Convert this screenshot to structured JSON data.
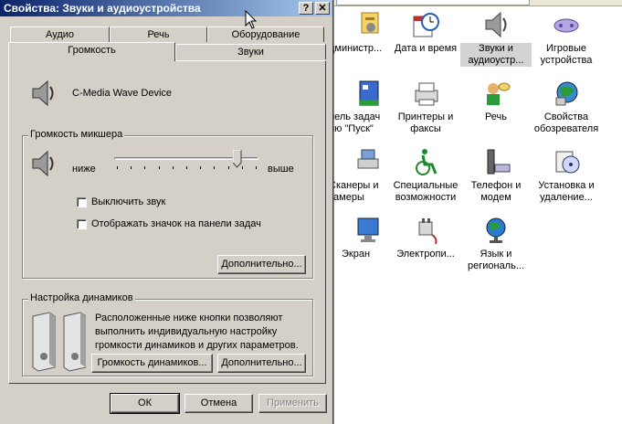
{
  "dialog": {
    "title": "Свойства: Звуки и аудиоустройства",
    "help_glyph": "?",
    "close_glyph": "✕",
    "tabs_back": [
      "Аудио",
      "Речь",
      "Оборудование"
    ],
    "tabs_front": [
      "Громкость",
      "Звуки"
    ],
    "active_tab": "Громкость",
    "device_name": "C-Media Wave Device",
    "mixer": {
      "group_label": "Громкость микшера",
      "low_label": "ниже",
      "high_label": "выше",
      "volume_level_fraction": 0.87,
      "mute_label": "Выключить звук",
      "mute_checked": false,
      "tray_icon_label": "Отображать значок на панели задач",
      "tray_icon_checked": false,
      "advanced_label": "Дополнительно..."
    },
    "speakers": {
      "group_label": "Настройка динамиков",
      "description": "Расположенные ниже кнопки позволяют выполнить индивидуальную настройку громкости динамиков и других параметров.",
      "desc_lines": [
        "Расположенные ниже кнопки позволяют",
        "выполнить индивидуальную настройку",
        "громкости динамиков и других параметров."
      ],
      "volume_button": "Громкость динамиков...",
      "advanced_button": "Дополнительно..."
    },
    "footer": {
      "ok": "ОК",
      "cancel": "Отмена",
      "apply": "Применить",
      "apply_enabled": false
    }
  },
  "control_panel": {
    "items": [
      {
        "label1": "дминистр...",
        "label2": "",
        "icon": "admin-tools-icon"
      },
      {
        "label1": "Дата и время",
        "label2": "",
        "icon": "calendar-clock-icon"
      },
      {
        "label1": "Звуки и",
        "label2": "аудиоустр...",
        "icon": "speaker-icon",
        "selected": true
      },
      {
        "label1": "Игровые",
        "label2": "устройства",
        "icon": "gamepad-icon"
      },
      {
        "label1": "нель задач",
        "label2": "ню \"Пуск\"",
        "icon": "taskbar-icon"
      },
      {
        "label1": "Принтеры и",
        "label2": "факсы",
        "icon": "printer-icon"
      },
      {
        "label1": "Речь",
        "label2": "",
        "icon": "speech-icon"
      },
      {
        "label1": "Свойства",
        "label2": "обозревателя",
        "icon": "internet-options-icon"
      },
      {
        "label1": "Сканеры и",
        "label2": "камеры",
        "icon": "scanner-icon"
      },
      {
        "label1": "Специальные",
        "label2": "возможности",
        "icon": "accessibility-icon"
      },
      {
        "label1": "Телефон и",
        "label2": "модем",
        "icon": "phone-modem-icon"
      },
      {
        "label1": "Установка и",
        "label2": "удаление...",
        "icon": "add-remove-icon"
      },
      {
        "label1": "Экран",
        "label2": "",
        "icon": "display-icon"
      },
      {
        "label1": "Электропи...",
        "label2": "",
        "icon": "power-icon"
      },
      {
        "label1": "Язык и",
        "label2": "региональ...",
        "icon": "globe-icon"
      }
    ]
  },
  "colors": {
    "title_start": "#0a246a",
    "title_end": "#a6caf0",
    "face": "#d4d0c8"
  }
}
